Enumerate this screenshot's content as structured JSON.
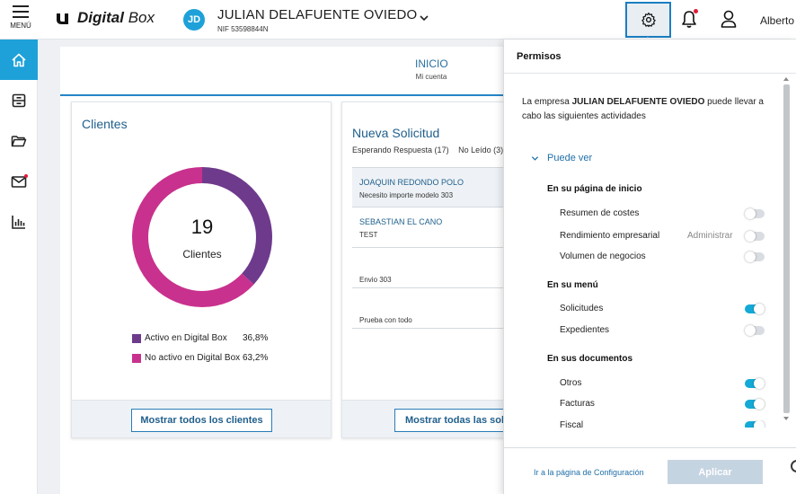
{
  "header": {
    "menu_label": "MENÚ",
    "logo_text_bold": "Digital",
    "logo_text": "Box",
    "avatar_initials": "JD",
    "company_name": "JULIAN DELAFUENTE OVIEDO",
    "company_nif": "NIF 53598844N",
    "user_name": "Alberto",
    "icons": [
      "gear-icon",
      "bell-icon",
      "user-icon",
      "chevron-down-icon"
    ]
  },
  "sidebar": {
    "items": [
      {
        "icon": "home-icon",
        "active": true
      },
      {
        "icon": "archive-icon",
        "active": false
      },
      {
        "icon": "folder-icon",
        "active": false
      },
      {
        "icon": "mail-icon",
        "active": false
      },
      {
        "icon": "bar-chart-icon",
        "active": false
      }
    ]
  },
  "tab": {
    "label": "INICIO",
    "sublabel": "Mi cuenta"
  },
  "clientes": {
    "title": "Clientes",
    "total": "19",
    "total_label": "Clientes",
    "legend": [
      {
        "label": "Activo en Digital Box",
        "value": "36,8%",
        "color": "#6e3a8c"
      },
      {
        "label": "No activo en Digital Box",
        "value": "63,2%",
        "color": "#c8318d"
      }
    ],
    "button": "Mostrar todos los clientes"
  },
  "chart_data": {
    "type": "pie",
    "categories": [
      "Activo en Digital Box",
      "No activo en Digital Box"
    ],
    "values": [
      36.8,
      63.2
    ],
    "title": "",
    "colors": [
      "#6e3a8c",
      "#c8318d"
    ]
  },
  "solicitud": {
    "title": "Nueva Solicitud",
    "filters": [
      "Esperando Respuesta (17)",
      "No Leído (3)"
    ],
    "items": [
      {
        "name": "JOAQUIN REDONDO POLO",
        "desc": "Necesito importe modelo 303"
      },
      {
        "name": "SEBASTIAN EL CANO",
        "desc": "TEST"
      },
      {
        "name": "",
        "desc": "Envio 303"
      },
      {
        "name": "",
        "desc": "Prueba con todo"
      }
    ],
    "button": "Mostrar todas las solicitudes"
  },
  "permisos": {
    "title": "Permisos",
    "intro_prefix": "La empresa ",
    "intro_company": "JULIAN DELAFUENTE OVIEDO",
    "intro_suffix": " puede llevar a cabo las siguientes actividades",
    "puede_ver": "Puede ver",
    "sections": [
      {
        "heading": "En su página de inicio",
        "rows": [
          {
            "label": "Resumen de costes",
            "on": false,
            "extra": ""
          },
          {
            "label": "Rendimiento empresarial",
            "on": false,
            "extra": "Administrar"
          },
          {
            "label": "Volumen de negocios",
            "on": false,
            "extra": ""
          }
        ]
      },
      {
        "heading": "En su menú",
        "rows": [
          {
            "label": "Solicitudes",
            "on": true,
            "extra": ""
          },
          {
            "label": "Expedientes",
            "on": false,
            "extra": ""
          }
        ]
      },
      {
        "heading": "En sus documentos",
        "rows": [
          {
            "label": "Otros",
            "on": true,
            "extra": ""
          },
          {
            "label": "Facturas",
            "on": true,
            "extra": ""
          },
          {
            "label": "Fiscal",
            "on": true,
            "extra": ""
          }
        ]
      }
    ],
    "config_link": "Ir a la página de Configuración",
    "apply_button": "Aplicar"
  }
}
